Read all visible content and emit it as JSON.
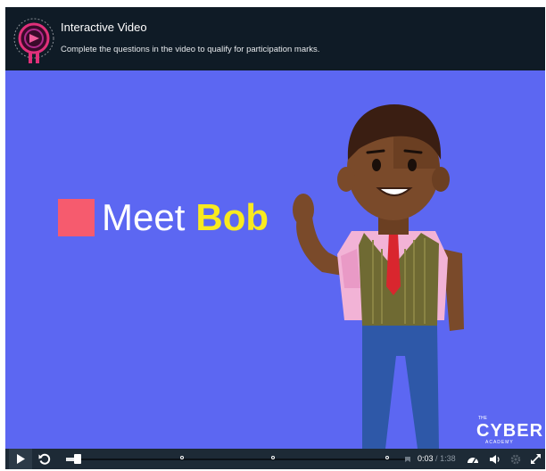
{
  "header": {
    "title": "Interactive Video",
    "subtitle": "Complete the questions in the video to qualify for participation marks."
  },
  "video": {
    "caption_word": "Meet",
    "caption_name": "Bob",
    "brand_small": "THE",
    "brand_main": "CYBER",
    "brand_sub": "ACADEMY"
  },
  "controls": {
    "current_time": "0:03",
    "separator": "/",
    "duration": "1:38",
    "progress_fraction": 0.03,
    "interaction_marker_times": [
      "0:38",
      "1:04",
      "1:30"
    ]
  },
  "colors": {
    "stage": "#5c67f2",
    "header": "#0f1b26",
    "accent_square": "#f65b6e",
    "name_yellow": "#f9ea1f"
  },
  "icons": [
    "h5p-logo-icon",
    "play-icon",
    "rewind-icon",
    "bookmark-icon",
    "playback-rate-icon",
    "volume-icon",
    "settings-icon",
    "fullscreen-icon"
  ]
}
